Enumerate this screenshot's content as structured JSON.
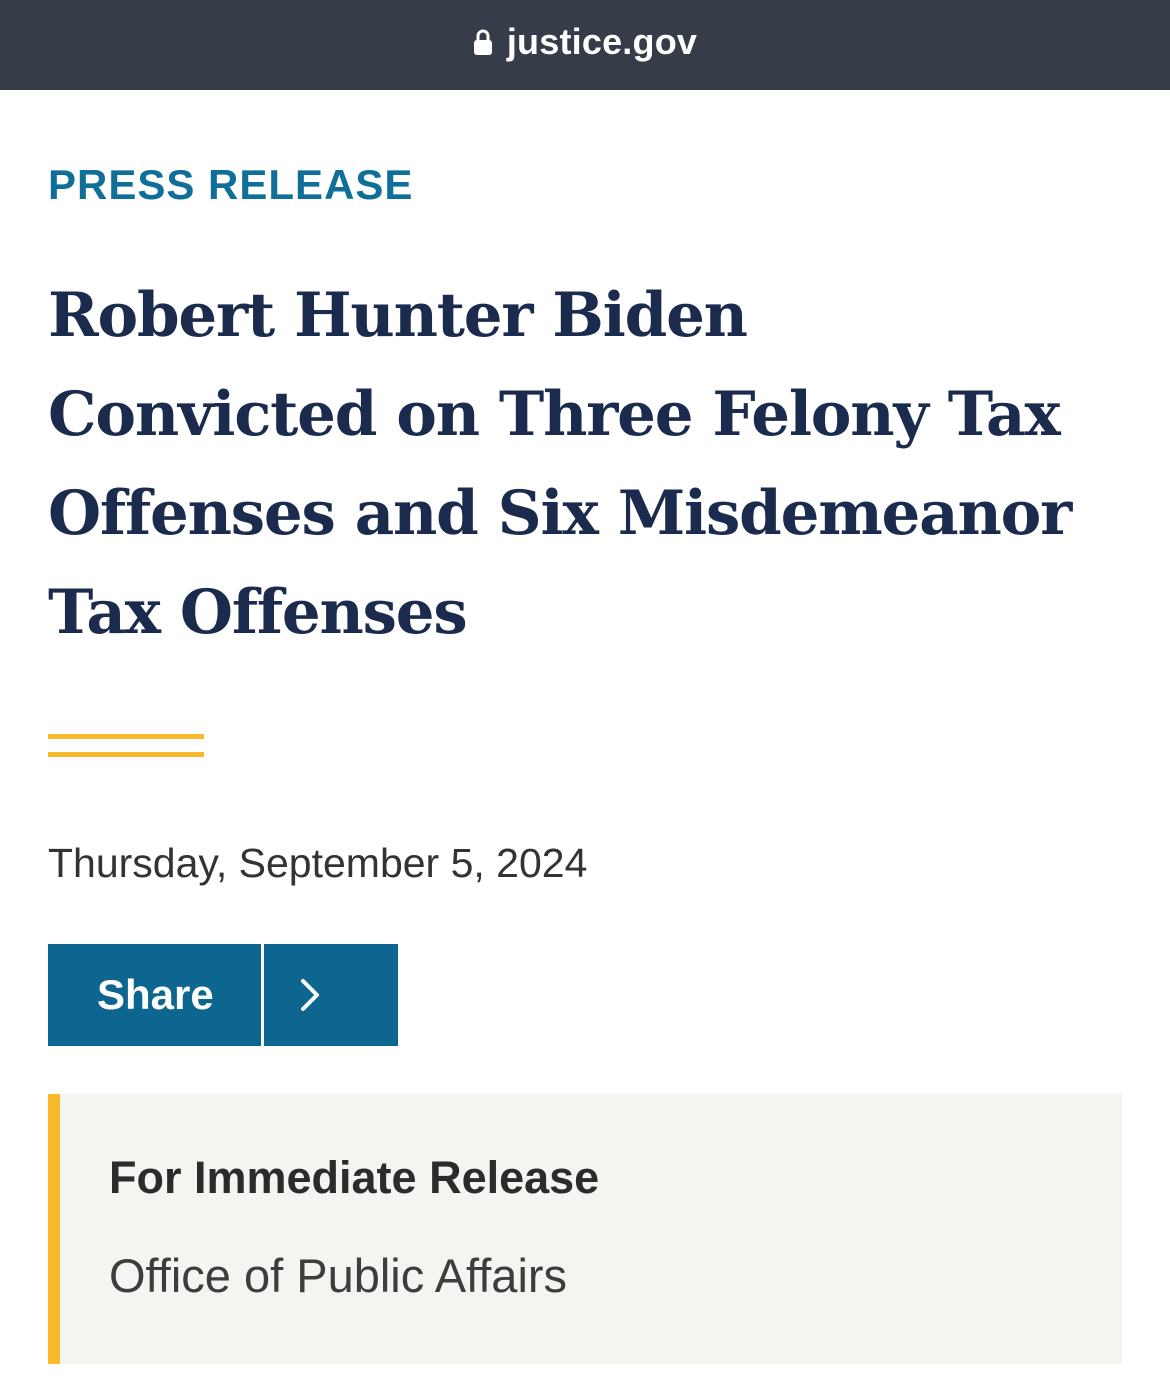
{
  "browser": {
    "url": "justice.gov",
    "lock_icon": "lock-icon"
  },
  "article": {
    "eyebrow": "PRESS RELEASE",
    "title_lines": [
      "Robert Hunter Biden",
      "Convicted on Three Felony Tax",
      "Offenses and Six Misdemeanor",
      "Tax Offenses"
    ],
    "date": "Thursday, September 5, 2024",
    "share": {
      "label": "Share",
      "arrow_icon": "chevron-right-icon"
    },
    "release_info": {
      "heading": "For Immediate Release",
      "office": "Office of Public Affairs"
    }
  },
  "colors": {
    "urlbar_bg": "#363d49",
    "eyebrow": "#106f99",
    "title": "#1b2b4e",
    "accent_gold": "#fab92b",
    "share_bg": "#0d6690",
    "release_bg": "#f4f4f1"
  }
}
